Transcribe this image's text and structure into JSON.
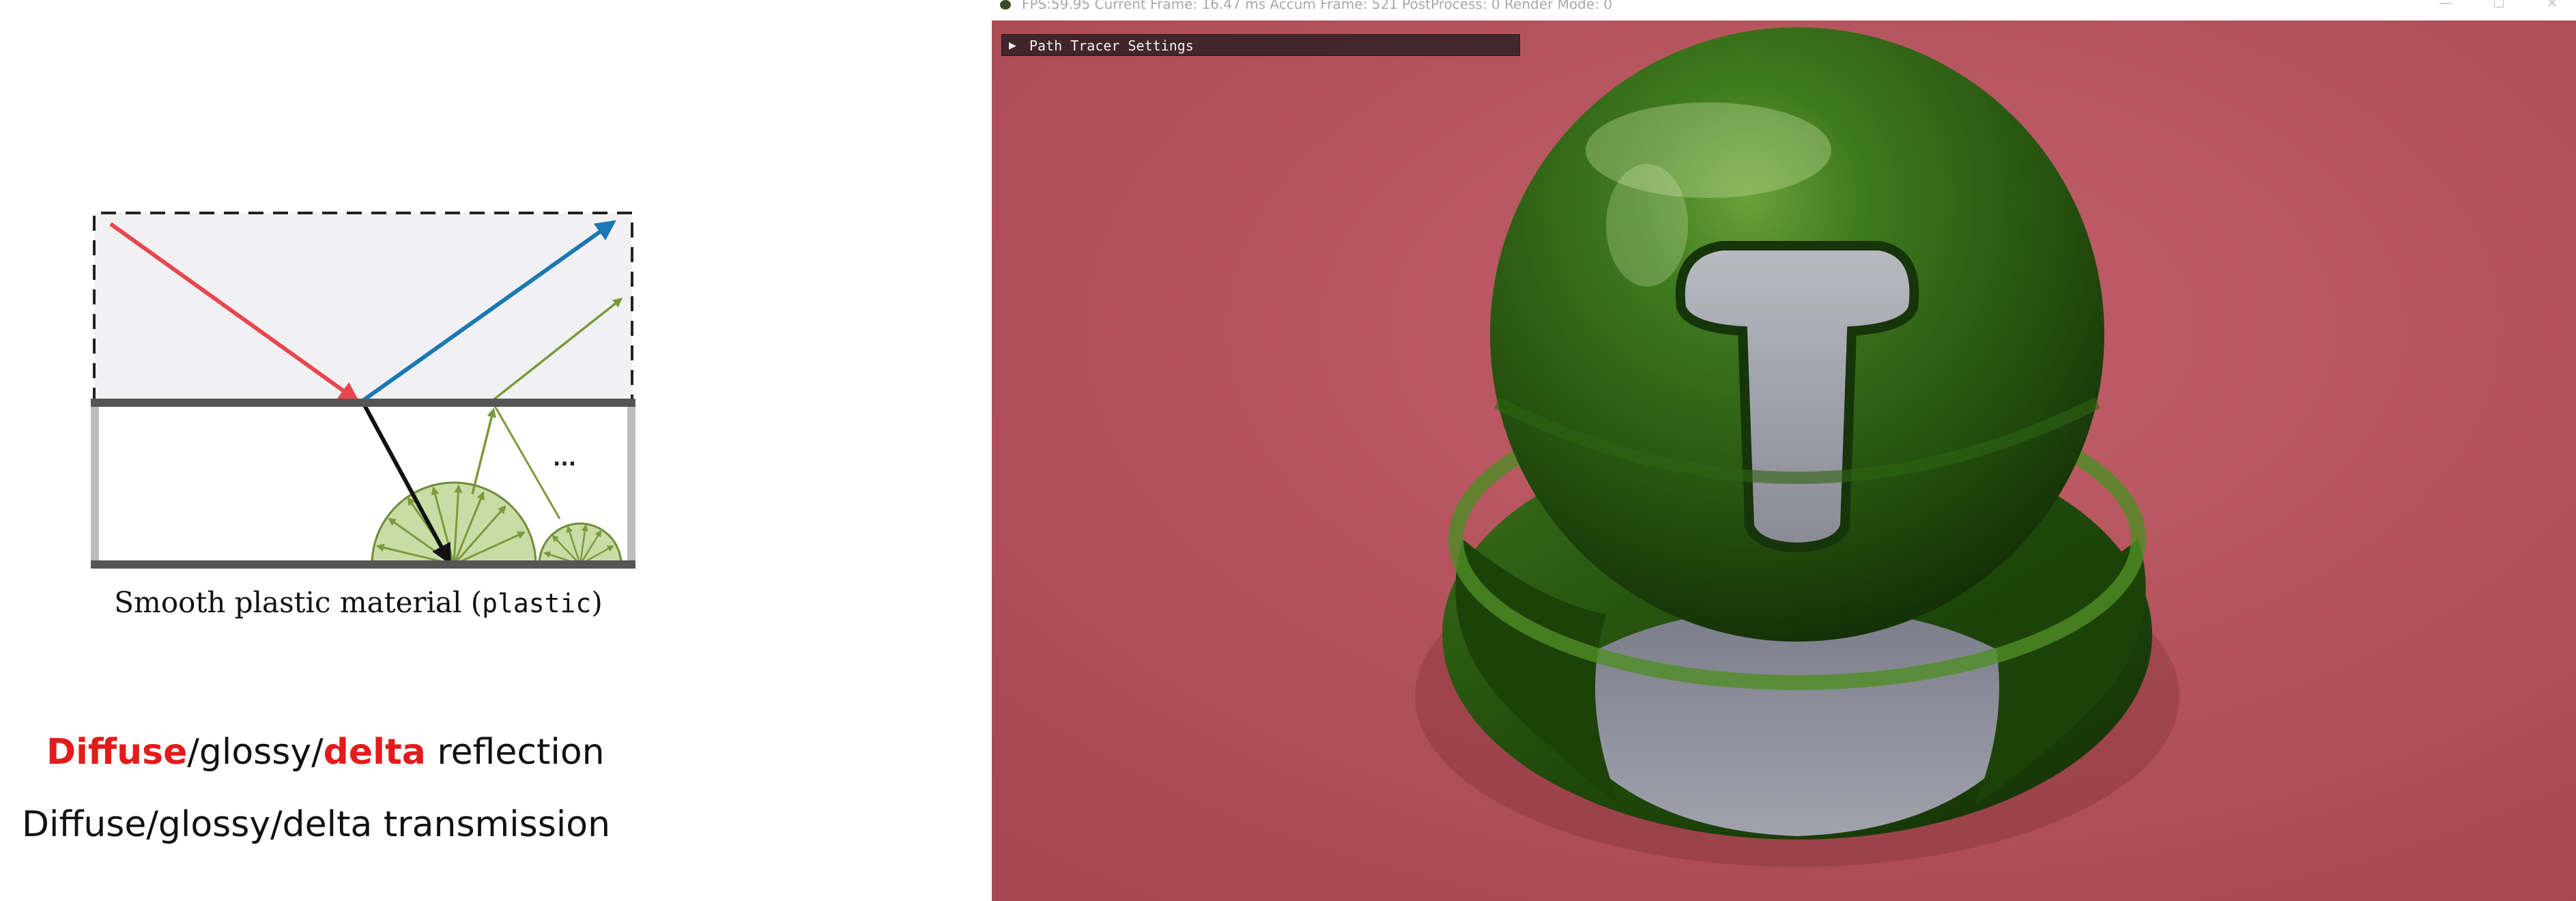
{
  "slide": {
    "diagram_ellipsis": "...",
    "caption": {
      "text": "Smooth plastic material (",
      "code": "plastic",
      "close": ")"
    },
    "reflection_line": {
      "w1": "Diffuse",
      "sep1": "/glossy/",
      "w2": "delta",
      "rest": " reflection"
    },
    "transmission_line": "Diffuse/glossy/delta transmission",
    "colors": {
      "highlight": "#e31b1b",
      "incident_ray": "#e8474f",
      "specular_ray": "#1a79b4",
      "diffuse_rays": "#7a9a3c",
      "lobe_fill": "#c9dca6",
      "coat_fill": "#f1f1f3"
    }
  },
  "render_window": {
    "status_bar": "FPS:59.95 Current Frame: 16.47 ms Accum Frame: 521 PostProcess: 0 Render Mode: 0",
    "controls": {
      "minimize": "—",
      "maximize": "☐",
      "close": "✕"
    },
    "settings_panel": {
      "arrow": "▶",
      "label": "Path Tracer Settings"
    },
    "colors": {
      "background": "#b5545e",
      "material": "#2c5c12",
      "inner_surface": "#8f8f9a"
    }
  }
}
